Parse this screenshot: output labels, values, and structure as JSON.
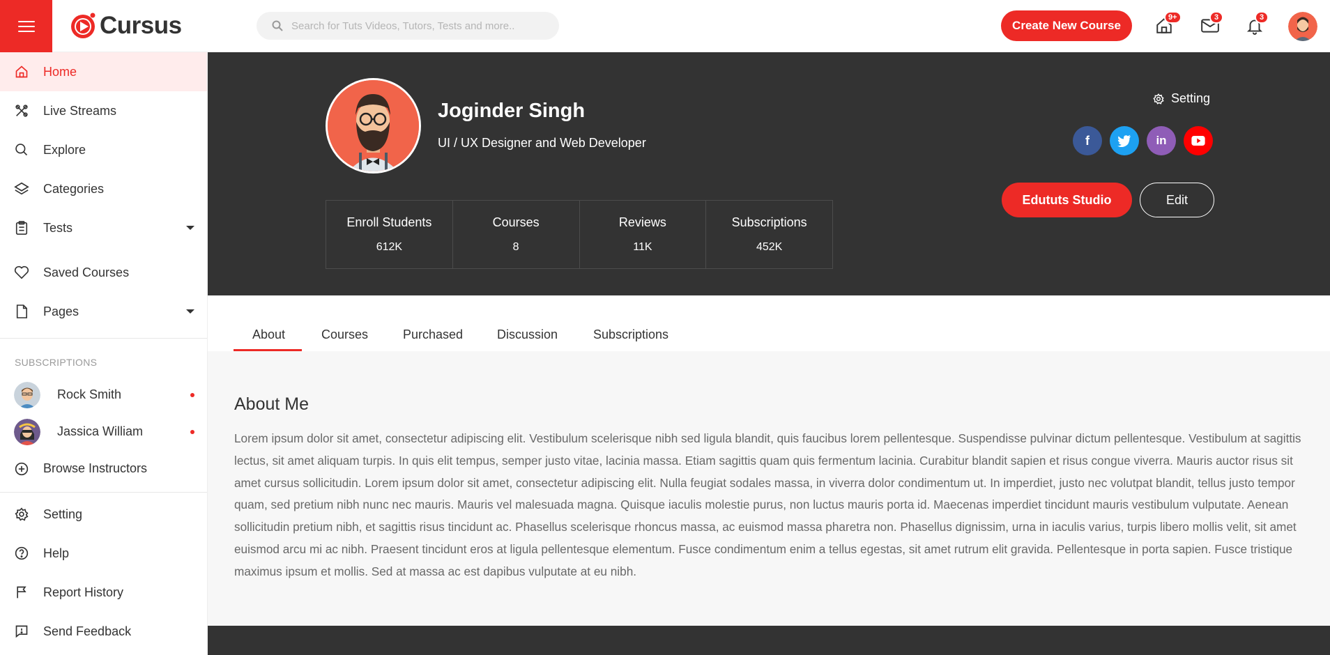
{
  "brand": {
    "name": "Cursus",
    "accent": "#ed2a26"
  },
  "header": {
    "search_placeholder": "Search for Tuts Videos, Tutors, Tests and more..",
    "create_button": "Create New Course",
    "icons": [
      {
        "name": "home-icon",
        "badge": "9+"
      },
      {
        "name": "mail-icon",
        "badge": "3"
      },
      {
        "name": "bell-icon",
        "badge": "3"
      }
    ]
  },
  "sidebar": {
    "items": [
      {
        "label": "Home",
        "icon": "home-icon",
        "active": true
      },
      {
        "label": "Live Streams",
        "icon": "broadcast-icon"
      },
      {
        "label": "Explore",
        "icon": "search-icon"
      },
      {
        "label": "Categories",
        "icon": "layers-icon"
      },
      {
        "label": "Tests",
        "icon": "clipboard-icon",
        "has_dropdown": true
      },
      {
        "label": "Saved Courses",
        "icon": "heart-icon"
      },
      {
        "label": "Pages",
        "icon": "file-icon",
        "has_dropdown": true
      }
    ],
    "subscriptions_heading": "SUBSCRIPTIONS",
    "subscriptions": [
      {
        "name": "Rock Smith"
      },
      {
        "name": "Jassica William"
      }
    ],
    "browse_label": "Browse Instructors",
    "bottom_items": [
      {
        "label": "Setting",
        "icon": "gear-icon"
      },
      {
        "label": "Help",
        "icon": "help-icon"
      },
      {
        "label": "Report History",
        "icon": "flag-icon"
      },
      {
        "label": "Send Feedback",
        "icon": "feedback-icon"
      }
    ]
  },
  "profile": {
    "name": "Joginder Singh",
    "title": "UI / UX Designer and Web Developer",
    "setting_label": "Setting",
    "stats": [
      {
        "label": "Enroll Students",
        "value": "612K"
      },
      {
        "label": "Courses",
        "value": "8"
      },
      {
        "label": "Reviews",
        "value": "11K"
      },
      {
        "label": "Subscriptions",
        "value": "452K"
      }
    ],
    "social": [
      {
        "name": "facebook",
        "glyph": "f",
        "color": "#3b5998"
      },
      {
        "name": "twitter",
        "glyph": "t",
        "color": "#1da1f2"
      },
      {
        "name": "linkedin",
        "glyph": "in",
        "color": "#8f5db7"
      },
      {
        "name": "youtube",
        "glyph": "▶",
        "color": "#ff0000"
      }
    ],
    "studio_button": "Edututs Studio",
    "edit_button": "Edit"
  },
  "tabs": [
    {
      "label": "About",
      "active": true
    },
    {
      "label": "Courses"
    },
    {
      "label": "Purchased"
    },
    {
      "label": "Discussion"
    },
    {
      "label": "Subscriptions"
    }
  ],
  "about": {
    "heading": "About Me",
    "text": "Lorem ipsum dolor sit amet, consectetur adipiscing elit. Vestibulum scelerisque nibh sed ligula blandit, quis faucibus lorem pellentesque. Suspendisse pulvinar dictum pellentesque. Vestibulum at sagittis lectus, sit amet aliquam turpis. In quis elit tempus, semper justo vitae, lacinia massa. Etiam sagittis quam quis fermentum lacinia. Curabitur blandit sapien et risus congue viverra. Mauris auctor risus sit amet cursus sollicitudin. Lorem ipsum dolor sit amet, consectetur adipiscing elit. Nulla feugiat sodales massa, in viverra dolor condimentum ut. In imperdiet, justo nec volutpat blandit, tellus justo tempor quam, sed pretium nibh nunc nec mauris. Mauris vel malesuada magna. Quisque iaculis molestie purus, non luctus mauris porta id. Maecenas imperdiet tincidunt mauris vestibulum vulputate. Aenean sollicitudin pretium nibh, et sagittis risus tincidunt ac. Phasellus scelerisque rhoncus massa, ac euismod massa pharetra non. Phasellus dignissim, urna in iaculis varius, turpis libero mollis velit, sit amet euismod arcu mi ac nibh. Praesent tincidunt eros at ligula pellentesque elementum. Fusce condimentum enim a tellus egestas, sit amet rutrum elit gravida. Pellentesque in porta sapien. Fusce tristique maximus ipsum et mollis. Sed at massa ac est dapibus vulputate at eu nibh."
  }
}
